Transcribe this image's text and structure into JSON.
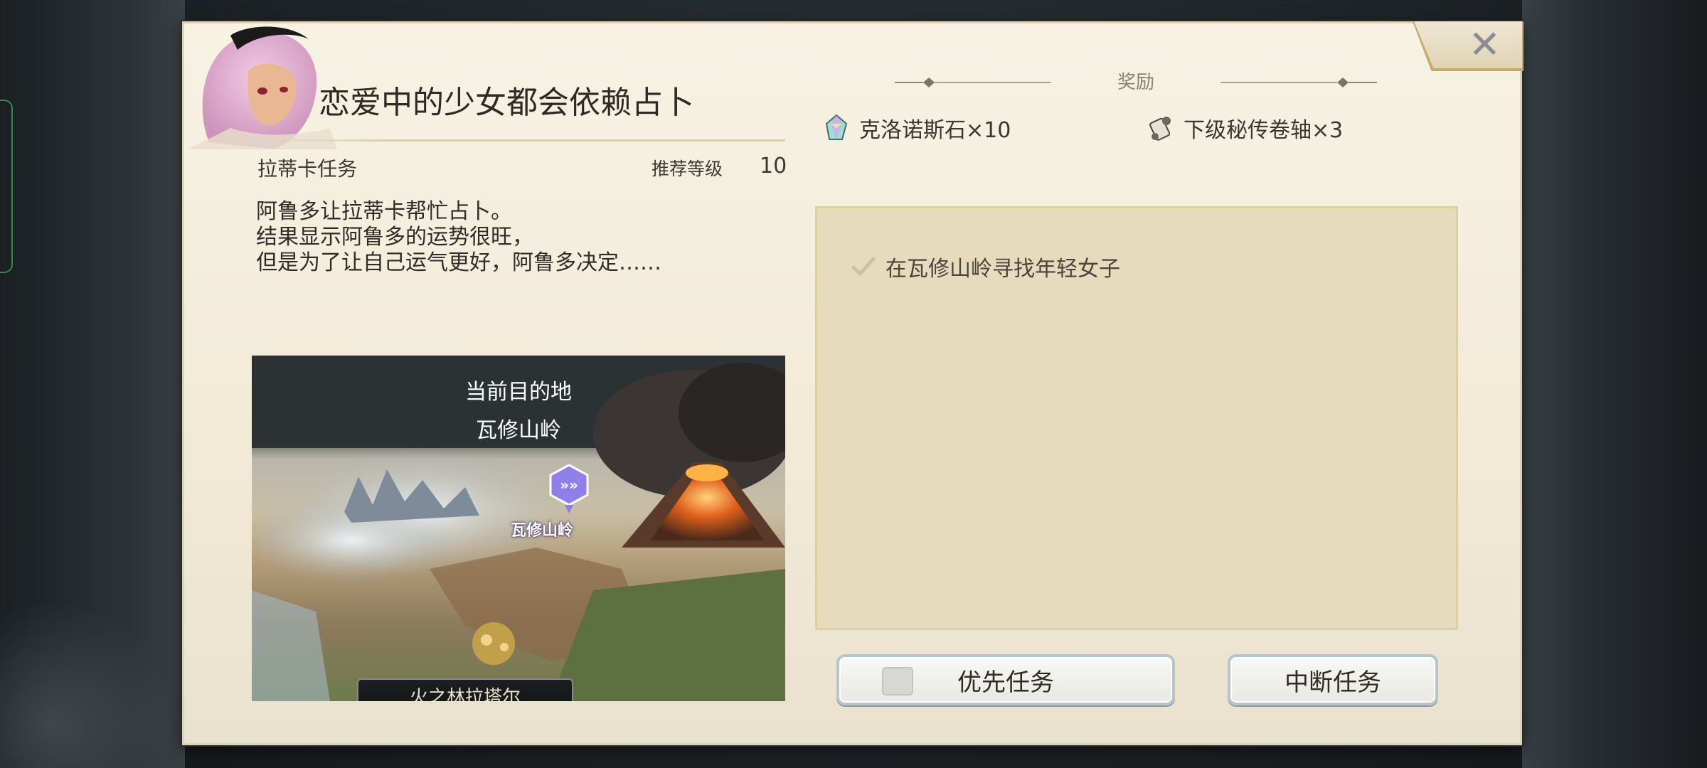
{
  "quest": {
    "title": "恋爱中的少女都会依赖占卜",
    "type": "拉蒂卡任务",
    "recommended_level_label": "推荐等级",
    "recommended_level": "10",
    "description": [
      "阿鲁多让拉蒂卡帮忙占卜。",
      "结果显示阿鲁多的运势很旺，",
      "但是为了让自己运气更好，阿鲁多决定……"
    ]
  },
  "map": {
    "heading": "当前目的地",
    "destination": "瓦修山岭",
    "marker_label": "瓦修山岭",
    "bottom_banner": "火之林拉塔尔"
  },
  "rewards": {
    "title": "奖励",
    "items": [
      {
        "icon": "crystal-stone-icon",
        "label": "克洛诺斯石×10"
      },
      {
        "icon": "scroll-icon",
        "label": "下级秘传卷轴×3"
      }
    ]
  },
  "objectives": [
    {
      "label": "在瓦修山岭寻找年轻女子",
      "completed": false
    }
  ],
  "buttons": {
    "priority": "优先任务",
    "abort": "中断任务"
  },
  "colors": {
    "panel_bg": "#f2ebd8",
    "objective_bg": "#e6dcbd",
    "accent_gold": "#c9a966"
  }
}
